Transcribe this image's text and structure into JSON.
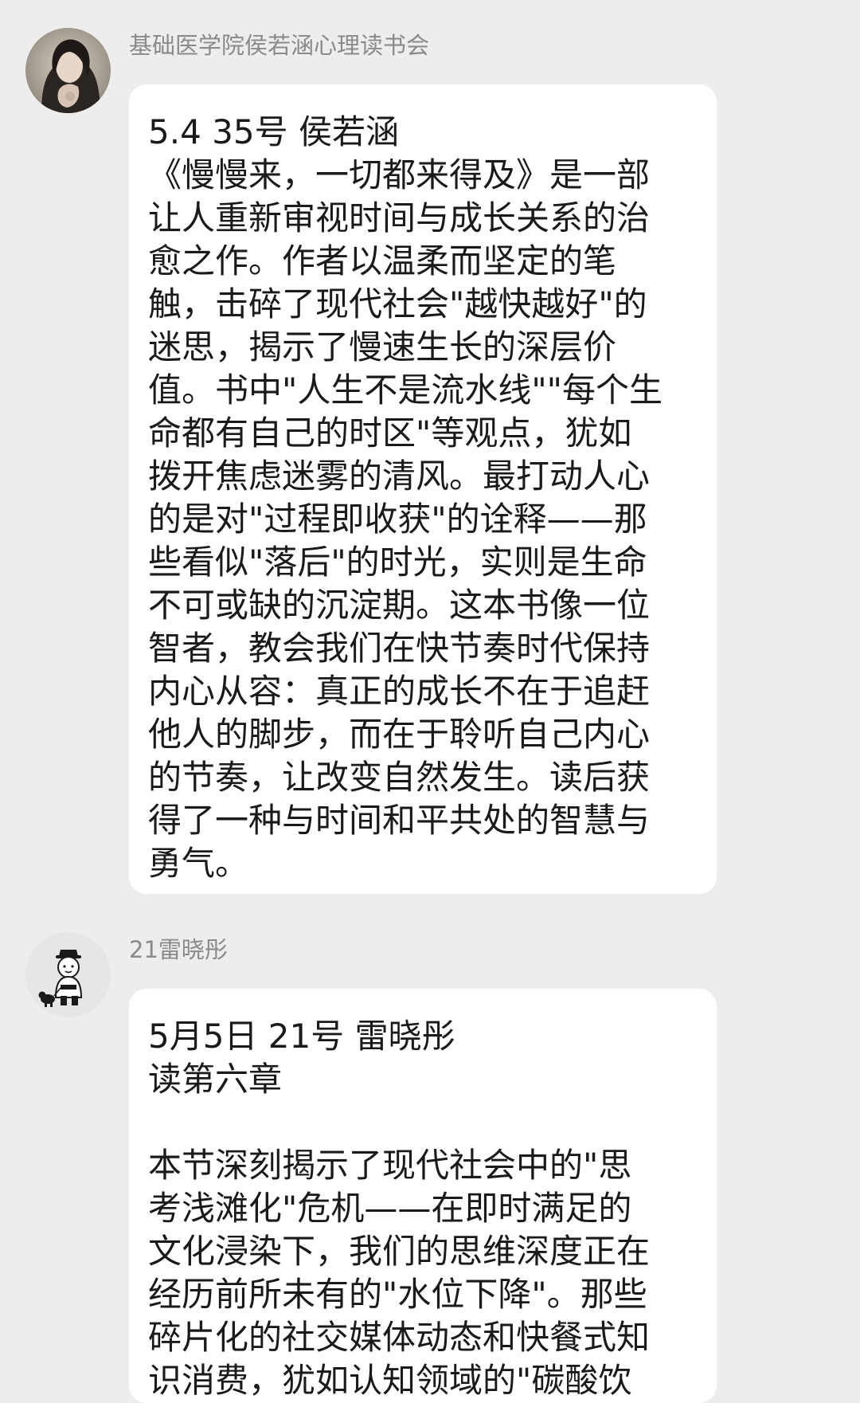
{
  "messages": [
    {
      "sender": "基础医学院侯若涵心理读书会",
      "avatar": "photo-avatar",
      "lines": [
        "5.4 35号 侯若涵",
        "《慢慢来，一切都来得及》是一部",
        "让人重新审视时间与成长关系的治",
        "愈之作。作者以温柔而坚定的笔",
        "触，击碎了现代社会\"越快越好\"的",
        "迷思，揭示了慢速生长的深层价",
        "值。书中\"人生不是流水线\"\"每个生",
        "命都有自己的时区\"等观点，犹如",
        "拨开焦虑迷雾的清风。最打动人心",
        "的是对\"过程即收获\"的诠释——那",
        "些看似\"落后\"的时光，实则是生命",
        "不可或缺的沉淀期。这本书像一位",
        "智者，教会我们在快节奏时代保持",
        "内心从容：真正的成长不在于追赶",
        "他人的脚步，而在于聆听自己内心",
        "的节奏，让改变自然发生。读后获",
        "得了一种与时间和平共处的智慧与",
        "勇气。"
      ]
    },
    {
      "sender": "21雷晓彤",
      "avatar": "cartoon-avatar",
      "lines": [
        "5月5日 21号  雷晓彤",
        "读第六章",
        "",
        "本节深刻揭示了现代社会中的\"思",
        "考浅滩化\"危机——在即时满足的",
        "文化浸染下，我们的思维深度正在",
        "经历前所未有的\"水位下降\"。那些",
        "碎片化的社交媒体动态和快餐式知",
        "识消费，犹如认知领域的\"碳酸饮"
      ]
    }
  ]
}
